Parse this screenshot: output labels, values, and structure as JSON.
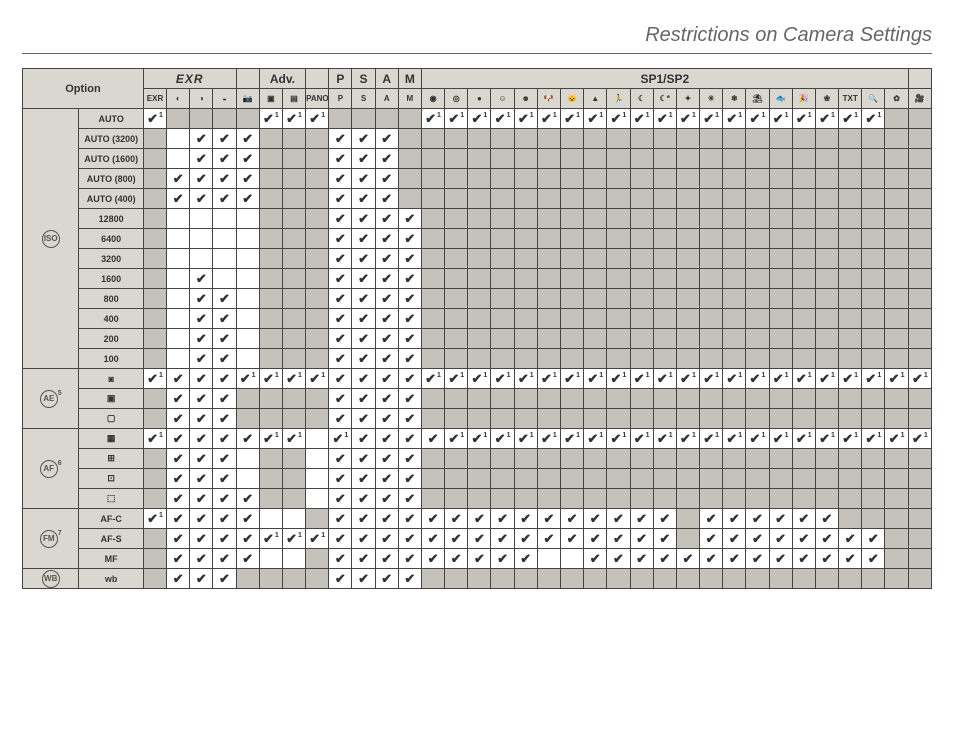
{
  "title": "Restrictions on Camera Settings",
  "chart_data": {
    "type": "table",
    "groups": [
      {
        "label": "EXR",
        "span": 4,
        "cls": "exr"
      },
      {
        "label": "",
        "span": 1
      },
      {
        "label": "Adv.",
        "span": 2
      },
      {
        "label": "",
        "span": 1
      },
      {
        "label": "P",
        "span": 1
      },
      {
        "label": "S",
        "span": 1
      },
      {
        "label": "A",
        "span": 1
      },
      {
        "label": "M",
        "span": 1
      },
      {
        "label": "SP1/SP2",
        "span": 21
      },
      {
        "label": "",
        "span": 1
      }
    ],
    "columns": [
      "EXR-Auto",
      "EXR-RP",
      "EXR-HR",
      "EXR-DR",
      "Auto",
      "Adv1",
      "Adv2",
      "Pano",
      "P",
      "S",
      "A",
      "M",
      "SP-NatPort",
      "SP-NatLight",
      "SP-NatFlash",
      "SP-Port",
      "SP-PortEnh",
      "SP-Dog",
      "SP-Cat",
      "SP-Landscape",
      "SP-Sport",
      "SP-Night",
      "SP-NightTripod",
      "SP-Fireworks",
      "SP-Sunset",
      "SP-Snow",
      "SP-Beach",
      "SP-Underwater",
      "SP-Party",
      "SP-Flower",
      "SP-Text",
      "SP-Macro",
      "SP-Extra",
      "Movie"
    ],
    "col_icons": [
      "EXR",
      "◐",
      "◑",
      "◒",
      "📷",
      "▣",
      "▤",
      "PANO",
      "P",
      "S",
      "A",
      "M",
      "◉",
      "◎",
      "●",
      "☺",
      "☻",
      "🐶",
      "🐱",
      "▲",
      "🏃",
      "☾",
      "☾*",
      "✦",
      "☀",
      "❄",
      "⛱",
      "🐟",
      "🎉",
      "❀",
      "TXT",
      "🔍",
      "✿",
      "🎥"
    ],
    "option_header": "Option",
    "side_groups": [
      {
        "icon": "ISO",
        "sup": "",
        "rows": [
          "AUTO",
          "AUTO (3200)",
          "AUTO (1600)",
          "AUTO (800)",
          "AUTO (400)",
          "12800",
          "6400",
          "3200",
          "1600",
          "800",
          "400",
          "200",
          "100"
        ]
      },
      {
        "icon": "AE",
        "sup": "5",
        "rows": [
          "ae-multi",
          "ae-spot",
          "ae-avg"
        ]
      },
      {
        "icon": "AF",
        "sup": "6",
        "rows": [
          "af-multi",
          "af-center",
          "af-area",
          "af-track"
        ]
      },
      {
        "icon": "FM",
        "sup": "7",
        "rows": [
          "AF-C",
          "AF-S",
          "MF"
        ]
      },
      {
        "icon": "WB",
        "sup": "",
        "rows": [
          "wb"
        ]
      }
    ],
    "row_labels": {
      "AUTO": "AUTO",
      "AUTO (3200)": "AUTO (3200)",
      "AUTO (1600)": "AUTO (1600)",
      "AUTO (800)": "AUTO (800)",
      "AUTO (400)": "AUTO (400)",
      "12800": "12800",
      "6400": "6400",
      "3200": "3200",
      "1600": "1600",
      "800": "800",
      "400": "400",
      "200": "200",
      "100": "100",
      "ae-multi": "◙",
      "ae-spot": "▣",
      "ae-avg": "▢",
      "af-multi": "▦",
      "af-center": "⊞",
      "af-area": "⊡",
      "af-track": "⬚",
      "AF-C": "AF-C",
      "AF-S": "AF-S",
      "MF": "MF",
      "wb": ""
    },
    "cells_comment": "Each row maps column-index (0-33) to one of: 'c'=white empty, 'g'=grey blocked, 'v'=white+check, 'v1'=white+check+superscript1",
    "rows": {
      "AUTO": [
        "v1",
        "g",
        "g",
        "g",
        "g",
        "v1",
        "v1",
        "v1",
        "g",
        "g",
        "g",
        "g",
        "v1",
        "v1",
        "v1",
        "v1",
        "v1",
        "v1",
        "v1",
        "v1",
        "v1",
        "v1",
        "v1",
        "v1",
        "v1",
        "v1",
        "v1",
        "v1",
        "v1",
        "v1",
        "v1",
        "v1",
        "g",
        "g"
      ],
      "AUTO (3200)": [
        "g",
        "c",
        "v",
        "v",
        "v",
        "g",
        "g",
        "g",
        "v",
        "v",
        "v",
        "g",
        "g",
        "g",
        "g",
        "g",
        "g",
        "g",
        "g",
        "g",
        "g",
        "g",
        "g",
        "g",
        "g",
        "g",
        "g",
        "g",
        "g",
        "g",
        "g",
        "g",
        "g",
        "g"
      ],
      "AUTO (1600)": [
        "g",
        "c",
        "v",
        "v",
        "v",
        "g",
        "g",
        "g",
        "v",
        "v",
        "v",
        "g",
        "g",
        "g",
        "g",
        "g",
        "g",
        "g",
        "g",
        "g",
        "g",
        "g",
        "g",
        "g",
        "g",
        "g",
        "g",
        "g",
        "g",
        "g",
        "g",
        "g",
        "g",
        "g"
      ],
      "AUTO (800)": [
        "g",
        "v",
        "v",
        "v",
        "v",
        "g",
        "g",
        "g",
        "v",
        "v",
        "v",
        "g",
        "g",
        "g",
        "g",
        "g",
        "g",
        "g",
        "g",
        "g",
        "g",
        "g",
        "g",
        "g",
        "g",
        "g",
        "g",
        "g",
        "g",
        "g",
        "g",
        "g",
        "g",
        "g"
      ],
      "AUTO (400)": [
        "g",
        "v",
        "v",
        "v",
        "v",
        "g",
        "g",
        "g",
        "v",
        "v",
        "v",
        "g",
        "g",
        "g",
        "g",
        "g",
        "g",
        "g",
        "g",
        "g",
        "g",
        "g",
        "g",
        "g",
        "g",
        "g",
        "g",
        "g",
        "g",
        "g",
        "g",
        "g",
        "g",
        "g"
      ],
      "12800": [
        "g",
        "c",
        "c",
        "c",
        "c",
        "g",
        "g",
        "g",
        "v",
        "v",
        "v",
        "v",
        "g",
        "g",
        "g",
        "g",
        "g",
        "g",
        "g",
        "g",
        "g",
        "g",
        "g",
        "g",
        "g",
        "g",
        "g",
        "g",
        "g",
        "g",
        "g",
        "g",
        "g",
        "g"
      ],
      "6400": [
        "g",
        "c",
        "c",
        "c",
        "c",
        "g",
        "g",
        "g",
        "v",
        "v",
        "v",
        "v",
        "g",
        "g",
        "g",
        "g",
        "g",
        "g",
        "g",
        "g",
        "g",
        "g",
        "g",
        "g",
        "g",
        "g",
        "g",
        "g",
        "g",
        "g",
        "g",
        "g",
        "g",
        "g"
      ],
      "3200": [
        "g",
        "c",
        "c",
        "c",
        "c",
        "g",
        "g",
        "g",
        "v",
        "v",
        "v",
        "v",
        "g",
        "g",
        "g",
        "g",
        "g",
        "g",
        "g",
        "g",
        "g",
        "g",
        "g",
        "g",
        "g",
        "g",
        "g",
        "g",
        "g",
        "g",
        "g",
        "g",
        "g",
        "g"
      ],
      "1600": [
        "g",
        "c",
        "v",
        "c",
        "c",
        "g",
        "g",
        "g",
        "v",
        "v",
        "v",
        "v",
        "g",
        "g",
        "g",
        "g",
        "g",
        "g",
        "g",
        "g",
        "g",
        "g",
        "g",
        "g",
        "g",
        "g",
        "g",
        "g",
        "g",
        "g",
        "g",
        "g",
        "g",
        "g"
      ],
      "800": [
        "g",
        "c",
        "v",
        "v",
        "c",
        "g",
        "g",
        "g",
        "v",
        "v",
        "v",
        "v",
        "g",
        "g",
        "g",
        "g",
        "g",
        "g",
        "g",
        "g",
        "g",
        "g",
        "g",
        "g",
        "g",
        "g",
        "g",
        "g",
        "g",
        "g",
        "g",
        "g",
        "g",
        "g"
      ],
      "400": [
        "g",
        "c",
        "v",
        "v",
        "c",
        "g",
        "g",
        "g",
        "v",
        "v",
        "v",
        "v",
        "g",
        "g",
        "g",
        "g",
        "g",
        "g",
        "g",
        "g",
        "g",
        "g",
        "g",
        "g",
        "g",
        "g",
        "g",
        "g",
        "g",
        "g",
        "g",
        "g",
        "g",
        "g"
      ],
      "200": [
        "g",
        "c",
        "v",
        "v",
        "c",
        "g",
        "g",
        "g",
        "v",
        "v",
        "v",
        "v",
        "g",
        "g",
        "g",
        "g",
        "g",
        "g",
        "g",
        "g",
        "g",
        "g",
        "g",
        "g",
        "g",
        "g",
        "g",
        "g",
        "g",
        "g",
        "g",
        "g",
        "g",
        "g"
      ],
      "100": [
        "g",
        "c",
        "v",
        "v",
        "c",
        "g",
        "g",
        "g",
        "v",
        "v",
        "v",
        "v",
        "g",
        "g",
        "g",
        "g",
        "g",
        "g",
        "g",
        "g",
        "g",
        "g",
        "g",
        "g",
        "g",
        "g",
        "g",
        "g",
        "g",
        "g",
        "g",
        "g",
        "g",
        "g"
      ],
      "ae-multi": [
        "v1",
        "v",
        "v",
        "v",
        "v1",
        "v1",
        "v1",
        "v1",
        "v",
        "v",
        "v",
        "v",
        "v1",
        "v1",
        "v1",
        "v1",
        "v1",
        "v1",
        "v1",
        "v1",
        "v1",
        "v1",
        "v1",
        "v1",
        "v1",
        "v1",
        "v1",
        "v1",
        "v1",
        "v1",
        "v1",
        "v1",
        "v1",
        "v1"
      ],
      "ae-spot": [
        "g",
        "v",
        "v",
        "v",
        "g",
        "g",
        "g",
        "g",
        "v",
        "v",
        "v",
        "v",
        "g",
        "g",
        "g",
        "g",
        "g",
        "g",
        "g",
        "g",
        "g",
        "g",
        "g",
        "g",
        "g",
        "g",
        "g",
        "g",
        "g",
        "g",
        "g",
        "g",
        "g",
        "g"
      ],
      "ae-avg": [
        "g",
        "v",
        "v",
        "v",
        "g",
        "g",
        "g",
        "g",
        "v",
        "v",
        "v",
        "v",
        "g",
        "g",
        "g",
        "g",
        "g",
        "g",
        "g",
        "g",
        "g",
        "g",
        "g",
        "g",
        "g",
        "g",
        "g",
        "g",
        "g",
        "g",
        "g",
        "g",
        "g",
        "g"
      ],
      "af-multi": [
        "v1",
        "v",
        "v",
        "v",
        "v",
        "v1",
        "v1",
        "c",
        "v1",
        "v",
        "v",
        "v",
        "v",
        "v1",
        "v1",
        "v1",
        "v1",
        "v1",
        "v1",
        "v1",
        "v1",
        "v1",
        "v1",
        "v1",
        "v1",
        "v1",
        "v1",
        "v1",
        "v1",
        "v1",
        "v1",
        "v1",
        "v1",
        "v1"
      ],
      "af-center": [
        "g",
        "v",
        "v",
        "v",
        "c",
        "g",
        "g",
        "c",
        "v",
        "v",
        "v",
        "v",
        "g",
        "g",
        "g",
        "g",
        "g",
        "g",
        "g",
        "g",
        "g",
        "g",
        "g",
        "g",
        "g",
        "g",
        "g",
        "g",
        "g",
        "g",
        "g",
        "g",
        "g",
        "g"
      ],
      "af-area": [
        "g",
        "v",
        "v",
        "v",
        "c",
        "g",
        "g",
        "c",
        "v",
        "v",
        "v",
        "v",
        "g",
        "g",
        "g",
        "g",
        "g",
        "g",
        "g",
        "g",
        "g",
        "g",
        "g",
        "g",
        "g",
        "g",
        "g",
        "g",
        "g",
        "g",
        "g",
        "g",
        "g",
        "g"
      ],
      "af-track": [
        "g",
        "v",
        "v",
        "v",
        "v",
        "g",
        "g",
        "c",
        "v",
        "v",
        "v",
        "v",
        "g",
        "g",
        "g",
        "g",
        "g",
        "g",
        "g",
        "g",
        "g",
        "g",
        "g",
        "g",
        "g",
        "g",
        "g",
        "g",
        "g",
        "g",
        "g",
        "g",
        "g",
        "g"
      ],
      "AF-C": [
        "v1",
        "v",
        "v",
        "v",
        "v",
        "c",
        "c",
        "g",
        "v",
        "v",
        "v",
        "v",
        "v",
        "v",
        "v",
        "v",
        "v",
        "v",
        "v",
        "v",
        "v",
        "v",
        "v",
        "g",
        "v",
        "v",
        "v",
        "v",
        "v",
        "v",
        "g",
        "g",
        "g",
        "g"
      ],
      "AF-S": [
        "g",
        "v",
        "v",
        "v",
        "v",
        "v1",
        "v1",
        "v1",
        "v",
        "v",
        "v",
        "v",
        "v",
        "v",
        "v",
        "v",
        "v",
        "v",
        "v",
        "v",
        "v",
        "v",
        "v",
        "g",
        "v",
        "v",
        "v",
        "v",
        "v",
        "v",
        "v",
        "v",
        "g",
        "g"
      ],
      "MF": [
        "g",
        "v",
        "v",
        "v",
        "v",
        "c",
        "c",
        "g",
        "v",
        "v",
        "v",
        "v",
        "v",
        "v",
        "v",
        "v",
        "v",
        "c",
        "c",
        "v",
        "v",
        "v",
        "v",
        "v",
        "v",
        "v",
        "v",
        "v",
        "v",
        "v",
        "v",
        "v",
        "g",
        "g"
      ],
      "wb": [
        "g",
        "v",
        "v",
        "v",
        "g",
        "g",
        "g",
        "g",
        "v",
        "v",
        "v",
        "v",
        "g",
        "g",
        "g",
        "g",
        "g",
        "g",
        "g",
        "g",
        "g",
        "g",
        "g",
        "g",
        "g",
        "g",
        "g",
        "g",
        "g",
        "g",
        "g",
        "g",
        "g",
        "g"
      ]
    }
  }
}
